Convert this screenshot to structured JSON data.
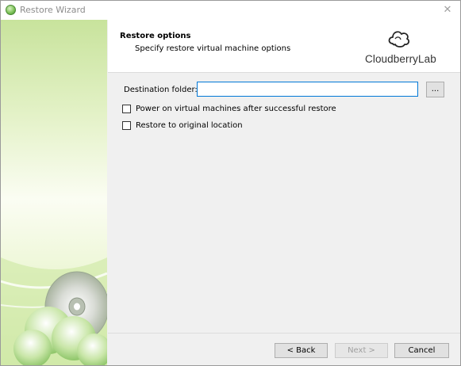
{
  "window": {
    "title": "Restore Wizard",
    "close_glyph": "✕",
    "app_icon": "restore-wizard-icon"
  },
  "header": {
    "title": "Restore options",
    "subtitle": "Specify restore virtual machine options",
    "logo_text": "CloudberryLab",
    "logo_icon": "cloud-icon"
  },
  "form": {
    "destination_label": "Destination folder:",
    "destination_value": "",
    "browse_label": "...",
    "options": [
      {
        "label": "Power on virtual machines after successful restore",
        "checked": false
      },
      {
        "label": "Restore to original location",
        "checked": false
      }
    ]
  },
  "footer": {
    "back_label": "< Back",
    "next_label": "Next >",
    "cancel_label": "Cancel",
    "next_enabled": false
  },
  "colors": {
    "accent": "#0078d7",
    "panel_green": "#c8e39c",
    "dialog_bg": "#f0f0f0"
  }
}
